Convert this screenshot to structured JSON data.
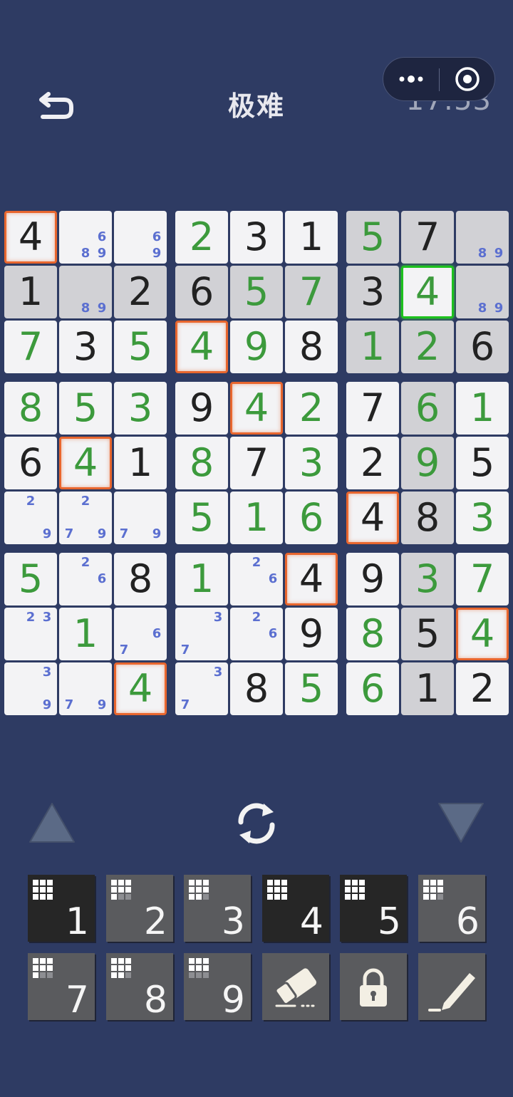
{
  "header": {
    "title": "极难",
    "timer": "17:53",
    "back_icon": "back-arrow-icon",
    "more_icon": "more-dots-icon",
    "close_icon": "target-close-icon"
  },
  "board": {
    "rows": [
      [
        {
          "v": 4,
          "t": "given",
          "sel": "orange"
        },
        {
          "notes": [
            6,
            8,
            9
          ]
        },
        {
          "notes": [
            6,
            9
          ]
        },
        {
          "v": 2,
          "t": "user"
        },
        {
          "v": 3,
          "t": "given"
        },
        {
          "v": 1,
          "t": "given"
        },
        {
          "v": 5,
          "t": "user",
          "hl": true
        },
        {
          "v": 7,
          "t": "given",
          "hl": true
        },
        {
          "notes": [
            8,
            9
          ],
          "hl": true
        }
      ],
      [
        {
          "v": 1,
          "t": "given",
          "hl": true
        },
        {
          "notes": [
            8,
            9
          ],
          "hl": true
        },
        {
          "v": 2,
          "t": "given",
          "hl": true
        },
        {
          "v": 6,
          "t": "given",
          "hl": true
        },
        {
          "v": 5,
          "t": "user",
          "hl": true
        },
        {
          "v": 7,
          "t": "user",
          "hl": true
        },
        {
          "v": 3,
          "t": "given",
          "hl": true
        },
        {
          "v": 4,
          "t": "user",
          "sel": "green"
        },
        {
          "notes": [
            8,
            9
          ],
          "hl": true
        }
      ],
      [
        {
          "v": 7,
          "t": "user"
        },
        {
          "v": 3,
          "t": "given"
        },
        {
          "v": 5,
          "t": "user"
        },
        {
          "v": 4,
          "t": "user",
          "sel": "orange"
        },
        {
          "v": 9,
          "t": "user"
        },
        {
          "v": 8,
          "t": "given"
        },
        {
          "v": 1,
          "t": "user",
          "hl": true
        },
        {
          "v": 2,
          "t": "user",
          "hl": true
        },
        {
          "v": 6,
          "t": "given",
          "hl": true
        }
      ],
      [
        {
          "v": 8,
          "t": "user"
        },
        {
          "v": 5,
          "t": "user"
        },
        {
          "v": 3,
          "t": "user"
        },
        {
          "v": 9,
          "t": "given"
        },
        {
          "v": 4,
          "t": "user",
          "sel": "orange"
        },
        {
          "v": 2,
          "t": "user"
        },
        {
          "v": 7,
          "t": "given"
        },
        {
          "v": 6,
          "t": "user",
          "hl": true
        },
        {
          "v": 1,
          "t": "user"
        }
      ],
      [
        {
          "v": 6,
          "t": "given"
        },
        {
          "v": 4,
          "t": "user",
          "sel": "orange"
        },
        {
          "v": 1,
          "t": "given"
        },
        {
          "v": 8,
          "t": "user"
        },
        {
          "v": 7,
          "t": "given"
        },
        {
          "v": 3,
          "t": "user"
        },
        {
          "v": 2,
          "t": "given"
        },
        {
          "v": 9,
          "t": "user",
          "hl": true
        },
        {
          "v": 5,
          "t": "given"
        }
      ],
      [
        {
          "notes": [
            2,
            9
          ]
        },
        {
          "notes": [
            2,
            7,
            9
          ]
        },
        {
          "notes": [
            7,
            9
          ]
        },
        {
          "v": 5,
          "t": "user"
        },
        {
          "v": 1,
          "t": "user"
        },
        {
          "v": 6,
          "t": "user"
        },
        {
          "v": 4,
          "t": "given",
          "sel": "orange"
        },
        {
          "v": 8,
          "t": "given",
          "hl": true
        },
        {
          "v": 3,
          "t": "user"
        }
      ],
      [
        {
          "v": 5,
          "t": "user"
        },
        {
          "notes": [
            2,
            6
          ]
        },
        {
          "v": 8,
          "t": "given"
        },
        {
          "v": 1,
          "t": "user"
        },
        {
          "notes": [
            2,
            6
          ]
        },
        {
          "v": 4,
          "t": "given",
          "sel": "orange"
        },
        {
          "v": 9,
          "t": "given"
        },
        {
          "v": 3,
          "t": "user",
          "hl": true
        },
        {
          "v": 7,
          "t": "user"
        }
      ],
      [
        {
          "notes": [
            2,
            3
          ]
        },
        {
          "v": 1,
          "t": "user"
        },
        {
          "notes": [
            6,
            7
          ]
        },
        {
          "notes": [
            3,
            7
          ]
        },
        {
          "notes": [
            2,
            6
          ]
        },
        {
          "v": 9,
          "t": "given"
        },
        {
          "v": 8,
          "t": "user"
        },
        {
          "v": 5,
          "t": "given",
          "hl": true
        },
        {
          "v": 4,
          "t": "user",
          "sel": "orange"
        }
      ],
      [
        {
          "notes": [
            3,
            9
          ]
        },
        {
          "notes": [
            7,
            9
          ]
        },
        {
          "v": 4,
          "t": "user",
          "sel": "orange"
        },
        {
          "notes": [
            3,
            7
          ]
        },
        {
          "v": 8,
          "t": "given"
        },
        {
          "v": 5,
          "t": "user"
        },
        {
          "v": 6,
          "t": "user"
        },
        {
          "v": 1,
          "t": "given",
          "hl": true
        },
        {
          "v": 2,
          "t": "given"
        }
      ]
    ]
  },
  "controls": {
    "up_icon": "triangle-up-icon",
    "rotate_icon": "rotate-icon",
    "down_icon": "triangle-down-icon"
  },
  "keypad": {
    "numbers": [
      {
        "label": "1",
        "dark": true,
        "filled": 9
      },
      {
        "label": "2",
        "dark": false,
        "filled": 7
      },
      {
        "label": "3",
        "dark": false,
        "filled": 8
      },
      {
        "label": "4",
        "dark": true,
        "filled": 9
      },
      {
        "label": "5",
        "dark": true,
        "filled": 9
      },
      {
        "label": "6",
        "dark": false,
        "filled": 8
      },
      {
        "label": "7",
        "dark": false,
        "filled": 7
      },
      {
        "label": "8",
        "dark": false,
        "filled": 8
      },
      {
        "label": "9",
        "dark": false,
        "filled": 6
      }
    ],
    "tools": [
      "eraser-icon",
      "lock-icon",
      "pencil-icon"
    ]
  },
  "colors": {
    "background": "#2e3b63",
    "given": "#222222",
    "user": "#3c9a3c",
    "note": "#5b6fd0",
    "select_orange": "#e8662e",
    "select_green": "#1ec21e",
    "highlight": "#d1d1d5"
  }
}
